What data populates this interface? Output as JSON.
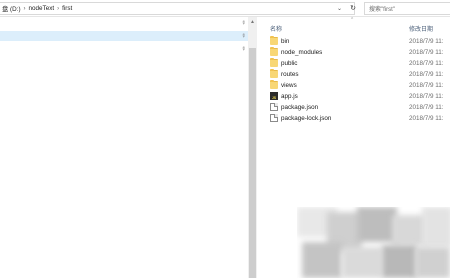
{
  "address_bar": {
    "crumbs": [
      "盘 (D:)",
      "nodeText",
      "first"
    ],
    "separator": "›",
    "dropdown_icon": "chevron-down-icon",
    "refresh_icon": "refresh-icon"
  },
  "search": {
    "placeholder": "搜索\"first\""
  },
  "file_list": {
    "columns": {
      "name": "名称",
      "date": "修改日期"
    },
    "items": [
      {
        "name": "bin",
        "type": "folder",
        "date": "2018/7/9 11:"
      },
      {
        "name": "node_modules",
        "type": "folder",
        "date": "2018/7/9 11:"
      },
      {
        "name": "public",
        "type": "folder",
        "date": "2018/7/9 11:"
      },
      {
        "name": "routes",
        "type": "folder",
        "date": "2018/7/9 11:"
      },
      {
        "name": "views",
        "type": "folder",
        "date": "2018/7/9 11:"
      },
      {
        "name": "app.js",
        "type": "js",
        "date": "2018/7/9 11:"
      },
      {
        "name": "package.json",
        "type": "file",
        "date": "2018/7/9 11:"
      },
      {
        "name": "package-lock.json",
        "type": "file",
        "date": "2018/7/9 11:"
      }
    ]
  },
  "colors": {
    "selected_nav": "#dceefb",
    "folder": "#f8d775",
    "header_text": "#4c607a"
  }
}
